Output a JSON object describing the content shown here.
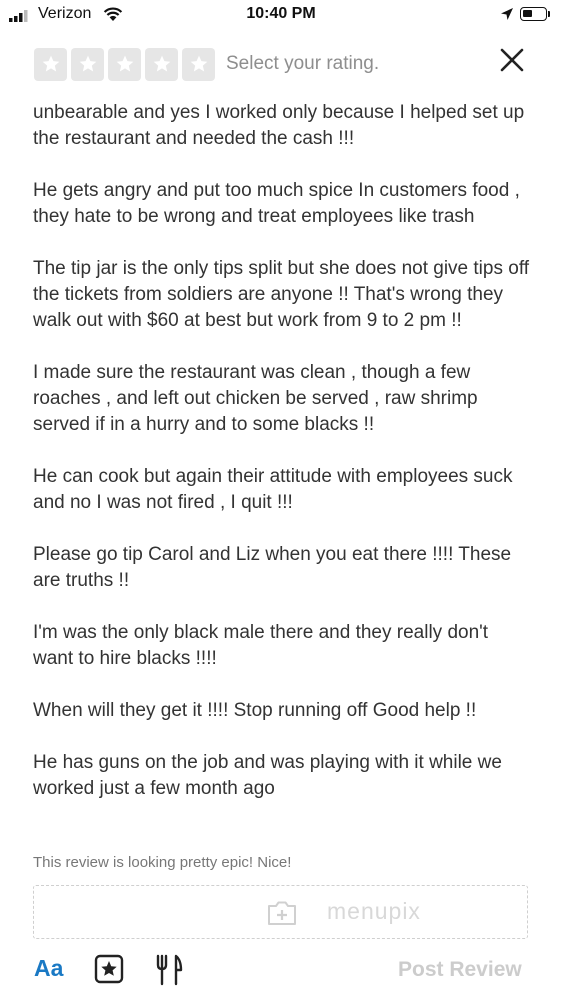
{
  "status_bar": {
    "carrier": "Verizon",
    "time": "10:40 PM",
    "battery_level": 0.45,
    "icons": [
      "signal-icon",
      "wifi-icon",
      "location-arrow-icon",
      "battery-icon"
    ]
  },
  "rating": {
    "placeholder": "Select your rating.",
    "stars_total": 5,
    "stars_selected": 0
  },
  "review_paragraphs": [
    "unbearable and yes I worked only because I helped set up the restaurant and needed the cash !!!",
    "He gets angry and put too much spice In customers food , they hate to be wrong and treat employees like trash",
    "The tip jar is the only tips split but she does not give tips off the tickets from soldiers are anyone !! That's wrong they walk out with $60 at best but work from 9 to 2 pm !!",
    "I made sure the restaurant was clean , though a few roaches , and left out chicken be served , raw shrimp served if in a hurry and to some blacks !!",
    "He can cook but again their attitude with employees suck and no I was not fired , I quit !!!",
    "Please go tip Carol and Liz when you eat there !!!! These are truths !!",
    "I'm was the only black male there and they really don't want to hire blacks !!!!",
    "When will they get it !!!!  Stop running off Good help !!",
    "He has guns on the job and was playing with it while we worked just a few month ago"
  ],
  "hint": "This review is looking pretty epic! Nice!",
  "photo_upload": {
    "icon": "add-photo-icon",
    "watermark": "menupix"
  },
  "toolbar": {
    "text_format_label": "Aa",
    "star_icon": "star-box-icon",
    "food_icon": "fork-knife-icon",
    "post_label": "Post Review"
  },
  "colors": {
    "accent": "#1a79c4",
    "star_empty": "#e6e6e6",
    "disabled": "#cccccc",
    "text": "#333333"
  }
}
